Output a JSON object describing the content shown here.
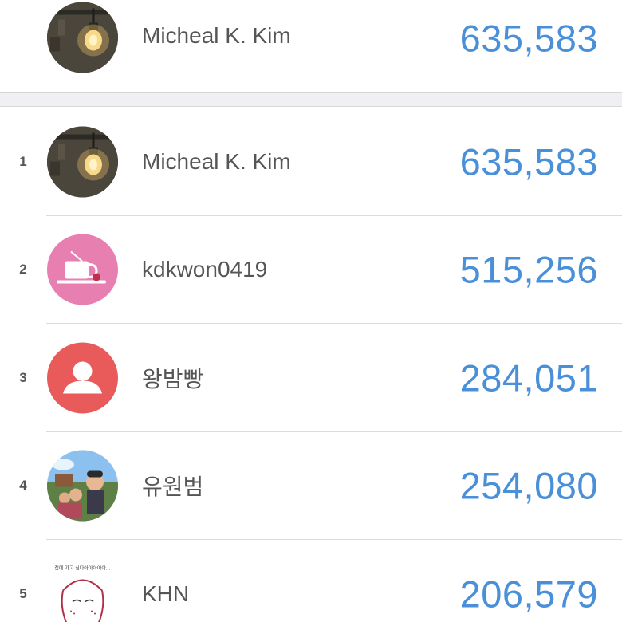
{
  "my_entry": {
    "name": "Micheal K. Kim",
    "score": "635,583",
    "avatar_icon": "light-bulb-photo"
  },
  "ranking": [
    {
      "rank": "1",
      "name": "Micheal K. Kim",
      "score": "635,583",
      "avatar_icon": "light-bulb-photo"
    },
    {
      "rank": "2",
      "name": "kdkwon0419",
      "score": "515,256",
      "avatar_icon": "coffee-cup-illustration"
    },
    {
      "rank": "3",
      "name": "왕밤빵",
      "score": "284,051",
      "avatar_icon": "default-user-silhouette"
    },
    {
      "rank": "4",
      "name": "유원범",
      "score": "254,080",
      "avatar_icon": "family-selfie-photo"
    },
    {
      "rank": "5",
      "name": "KHN",
      "score": "206,579",
      "avatar_icon": "cartoon-drawing"
    }
  ],
  "drawing_caption": "집에 가고 싶다아아아아아...",
  "colors": {
    "score": "#4a90d9",
    "name": "#555555",
    "separator": "#efeff4",
    "cup_avatar_bg": "#e77fb0",
    "default_avatar_bg": "#e95b5b"
  }
}
